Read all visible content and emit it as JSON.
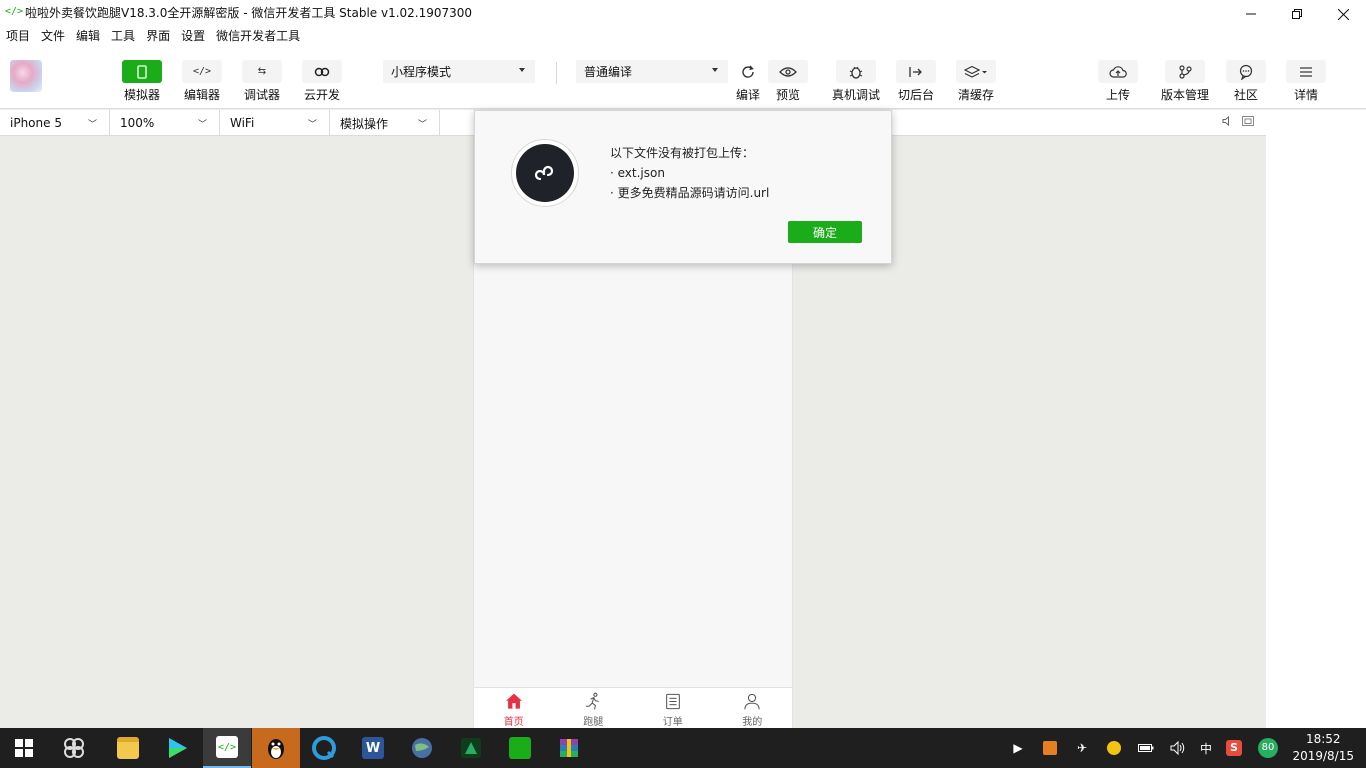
{
  "window": {
    "title": "啦啦外卖餐饮跑腿V18.3.0全开源解密版 - 微信开发者工具 Stable v1.02.1907300",
    "app_icon": "</>"
  },
  "menu": [
    "项目",
    "文件",
    "编辑",
    "工具",
    "界面",
    "设置",
    "微信开发者工具"
  ],
  "toolbar": {
    "simulator": "模拟器",
    "editor": "编辑器",
    "debugger": "调试器",
    "cloud": "云开发",
    "mode_select": "小程序模式",
    "compile_select": "普通编译",
    "compile": "编译",
    "preview": "预览",
    "remote_debug": "真机调试",
    "background": "切后台",
    "clear_cache": "清缓存",
    "upload": "上传",
    "version": "版本管理",
    "community": "社区",
    "details": "详情"
  },
  "devicebar": {
    "device": "iPhone 5",
    "zoom": "100%",
    "network": "WiFi",
    "operation": "模拟操作"
  },
  "modal": {
    "line1": "以下文件没有被打包上传：",
    "line2": "· ext.json",
    "line3": "· 更多免费精品源码请访问.url",
    "ok": "确定"
  },
  "tabbar": [
    {
      "label": "首页"
    },
    {
      "label": "跑腿"
    },
    {
      "label": "订单"
    },
    {
      "label": "我的"
    }
  ],
  "taskbar": {
    "input_method": "中",
    "badge": "80",
    "time": "18:52",
    "date": "2019/8/15"
  },
  "colors": {
    "accent": "#1aad19",
    "tab_active": "#e63145"
  }
}
